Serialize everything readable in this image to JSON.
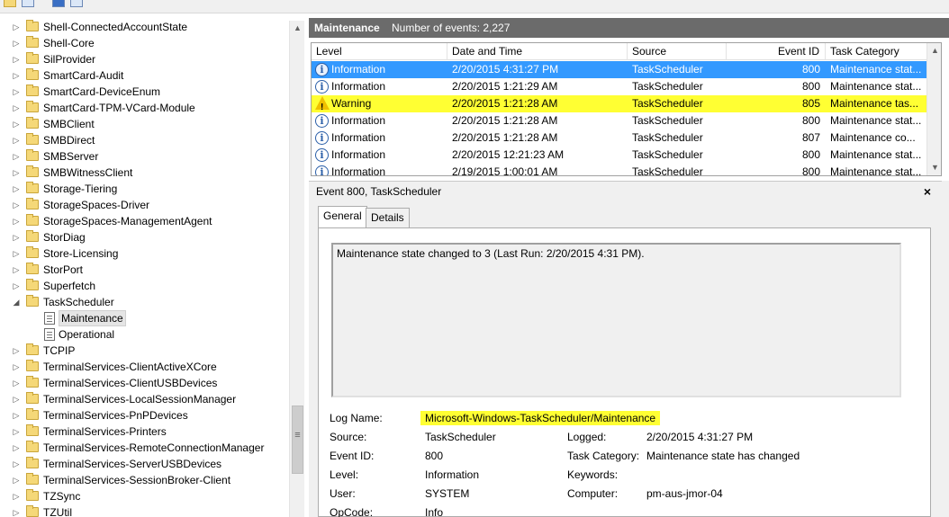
{
  "tree": {
    "items": [
      {
        "label": "Shell-ConnectedAccountState",
        "type": "folder"
      },
      {
        "label": "Shell-Core",
        "type": "folder"
      },
      {
        "label": "SilProvider",
        "type": "folder"
      },
      {
        "label": "SmartCard-Audit",
        "type": "folder"
      },
      {
        "label": "SmartCard-DeviceEnum",
        "type": "folder"
      },
      {
        "label": "SmartCard-TPM-VCard-Module",
        "type": "folder"
      },
      {
        "label": "SMBClient",
        "type": "folder"
      },
      {
        "label": "SMBDirect",
        "type": "folder"
      },
      {
        "label": "SMBServer",
        "type": "folder"
      },
      {
        "label": "SMBWitnessClient",
        "type": "folder"
      },
      {
        "label": "Storage-Tiering",
        "type": "folder"
      },
      {
        "label": "StorageSpaces-Driver",
        "type": "folder"
      },
      {
        "label": "StorageSpaces-ManagementAgent",
        "type": "folder"
      },
      {
        "label": "StorDiag",
        "type": "folder"
      },
      {
        "label": "Store-Licensing",
        "type": "folder"
      },
      {
        "label": "StorPort",
        "type": "folder"
      },
      {
        "label": "Superfetch",
        "type": "folder"
      },
      {
        "label": "TaskScheduler",
        "type": "folder-open"
      },
      {
        "label": "Maintenance",
        "type": "log-selected"
      },
      {
        "label": "Operational",
        "type": "log"
      },
      {
        "label": "TCPIP",
        "type": "folder"
      },
      {
        "label": "TerminalServices-ClientActiveXCore",
        "type": "folder"
      },
      {
        "label": "TerminalServices-ClientUSBDevices",
        "type": "folder"
      },
      {
        "label": "TerminalServices-LocalSessionManager",
        "type": "folder"
      },
      {
        "label": "TerminalServices-PnPDevices",
        "type": "folder"
      },
      {
        "label": "TerminalServices-Printers",
        "type": "folder"
      },
      {
        "label": "TerminalServices-RemoteConnectionManager",
        "type": "folder"
      },
      {
        "label": "TerminalServices-ServerUSBDevices",
        "type": "folder"
      },
      {
        "label": "TerminalServices-SessionBroker-Client",
        "type": "folder"
      },
      {
        "label": "TZSync",
        "type": "folder"
      },
      {
        "label": "TZUtil",
        "type": "folder"
      }
    ]
  },
  "log_header": {
    "title": "Maintenance",
    "count": "Number of events: 2,227"
  },
  "grid": {
    "columns": [
      "Level",
      "Date and Time",
      "Source",
      "Event ID",
      "Task Category"
    ],
    "rows": [
      {
        "level": "Information",
        "date": "2/20/2015 4:31:27 PM",
        "source": "TaskScheduler",
        "id": "800",
        "category": "Maintenance stat...",
        "state": "selected"
      },
      {
        "level": "Information",
        "date": "2/20/2015 1:21:29 AM",
        "source": "TaskScheduler",
        "id": "800",
        "category": "Maintenance stat...",
        "state": ""
      },
      {
        "level": "Warning",
        "date": "2/20/2015 1:21:28 AM",
        "source": "TaskScheduler",
        "id": "805",
        "category": "Maintenance tas...",
        "state": "warn"
      },
      {
        "level": "Information",
        "date": "2/20/2015 1:21:28 AM",
        "source": "TaskScheduler",
        "id": "800",
        "category": "Maintenance stat...",
        "state": ""
      },
      {
        "level": "Information",
        "date": "2/20/2015 1:21:28 AM",
        "source": "TaskScheduler",
        "id": "807",
        "category": "Maintenance co...",
        "state": ""
      },
      {
        "level": "Information",
        "date": "2/20/2015 12:21:23 AM",
        "source": "TaskScheduler",
        "id": "800",
        "category": "Maintenance stat...",
        "state": ""
      },
      {
        "level": "Information",
        "date": "2/19/2015 1:00:01 AM",
        "source": "TaskScheduler",
        "id": "800",
        "category": "Maintenance stat...",
        "state": ""
      }
    ]
  },
  "details": {
    "title": "Event 800, TaskScheduler",
    "close": "×",
    "tabs": [
      "General",
      "Details"
    ],
    "message": "Maintenance state changed to 3 (Last Run: 2/20/2015 4:31 PM).",
    "fields": {
      "log_name_label": "Log Name:",
      "log_name": "Microsoft-Windows-TaskScheduler/Maintenance",
      "source_label": "Source:",
      "source": "TaskScheduler",
      "logged_label": "Logged:",
      "logged": "2/20/2015 4:31:27 PM",
      "event_id_label": "Event ID:",
      "event_id": "800",
      "task_category_label": "Task Category:",
      "task_category": "Maintenance state has changed",
      "level_label": "Level:",
      "level": "Information",
      "keywords_label": "Keywords:",
      "keywords": "",
      "user_label": "User:",
      "user": "SYSTEM",
      "computer_label": "Computer:",
      "computer": "pm-aus-jmor-04",
      "opcode_label": "OpCode:",
      "opcode": "Info"
    }
  },
  "colors": {
    "selected_row": "#3399ff",
    "warning_row": "#ffff33",
    "header_bar": "#6b6b6b"
  },
  "icons": {
    "info": "i",
    "warn": "!",
    "scroll_up": "▲",
    "scroll_down": "▼",
    "gripper": "≡"
  }
}
